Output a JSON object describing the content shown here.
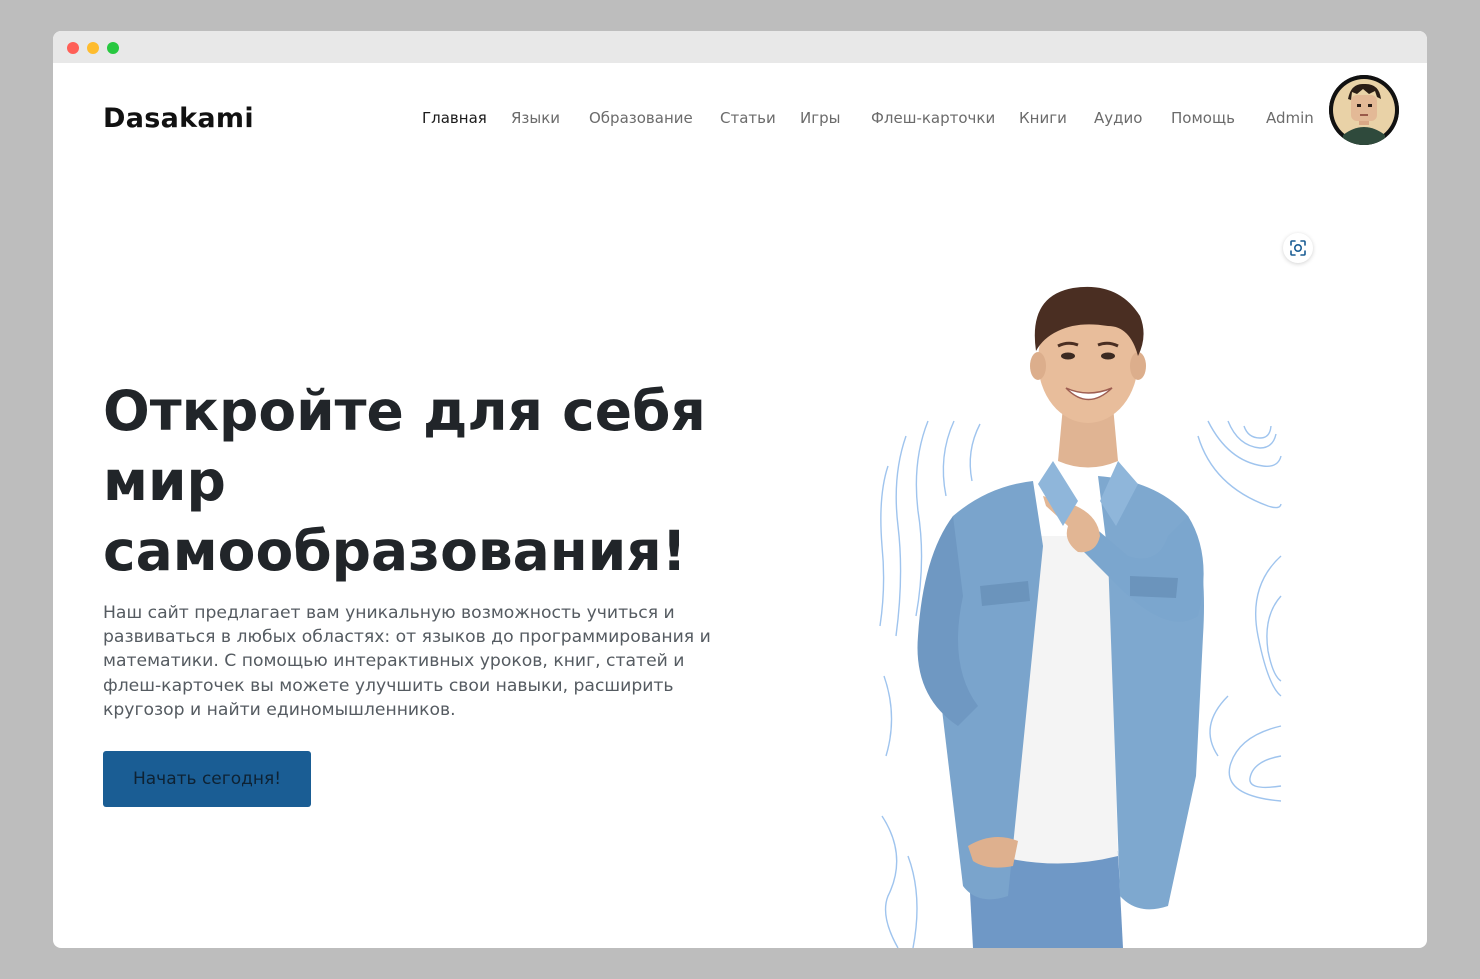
{
  "header": {
    "brand": "Dasakami",
    "nav": [
      {
        "label": "Главная",
        "active": true
      },
      {
        "label": "Языки",
        "active": false
      },
      {
        "label": "Образование",
        "active": false
      },
      {
        "label": "Статьи",
        "active": false
      },
      {
        "label": "Игры",
        "active": false
      },
      {
        "label": "Флеш-карточки",
        "active": false
      },
      {
        "label": "Книги",
        "active": false
      },
      {
        "label": "Аудио",
        "active": false
      },
      {
        "label": "Помощь",
        "active": false
      },
      {
        "label": "Admin",
        "active": false
      }
    ],
    "avatar_icon": "pixel-art-user-avatar"
  },
  "hero": {
    "title_line1": "Откройте для себя",
    "title_line2": "мир",
    "title_line3": "самообразования!",
    "description": "Наш сайт предлагает вам уникальную возможность учиться и развиваться в любых областях: от языков до программирования и математики. С помощью интерактивных уроков, книг, статей и флеш-карточек вы можете улучшить свои навыки, расширить кругозор и найти единомышленников.",
    "cta_label": "Начать сегодня!",
    "image_icon": "smiling-man-pointing-photo",
    "lens_icon": "visual-search-icon"
  },
  "colors": {
    "accent": "#1a5d94",
    "title": "#212529",
    "text": "#555b61",
    "nav_inactive": "#6b6b6b",
    "nav_active": "#1a1a1a",
    "pattern": "#9fc4ee"
  }
}
